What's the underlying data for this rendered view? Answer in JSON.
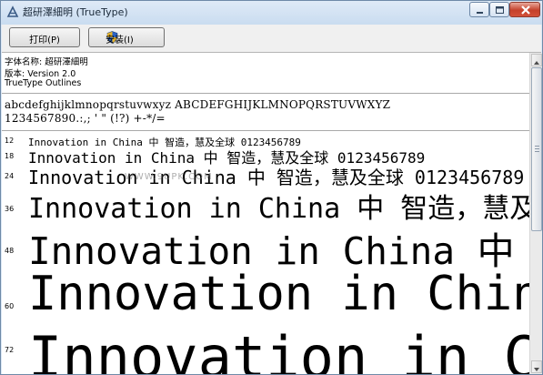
{
  "window": {
    "title": "超研澤細明 (TrueType)"
  },
  "toolbar": {
    "print_label": "打印(P)",
    "install_label": "安装(I)"
  },
  "font_info": {
    "name_line": "字体名称: 超研澤細明",
    "version_line": "版本: Version 2.0",
    "type_line": "TrueType Outlines"
  },
  "charset": {
    "line1": "abcdefghijklmnopqrstuvwxyz ABCDEFGHIJKLMNOPQRSTUVWXYZ",
    "line2": "1234567890.:,; ' \" (!?) +-*/="
  },
  "samples": [
    {
      "size": "12",
      "text": "Innovation in China 中  智造，慧及全球 0123456789"
    },
    {
      "size": "18",
      "text": "Innovation in China 中  智造，慧及全球 0123456789"
    },
    {
      "size": "24",
      "text": "Innovation in China 中  智造，慧及全球 0123456789"
    },
    {
      "size": "36",
      "text": "Innovation in China 中  智造，慧及全球"
    },
    {
      "size": "48",
      "text": "Innovation in China 中"
    },
    {
      "size": "60",
      "text": "Innovation in China"
    },
    {
      "size": "72",
      "text": "Innovation in China"
    }
  ],
  "watermark": "WWW.9UPK.COM",
  "colors": {
    "titlebar": "#c9dcf0",
    "close_button": "#c5412b",
    "text": "#000000",
    "background": "#ffffff"
  },
  "icons": {
    "app": "font-viewer-icon",
    "install": "uac-shield-icon"
  }
}
